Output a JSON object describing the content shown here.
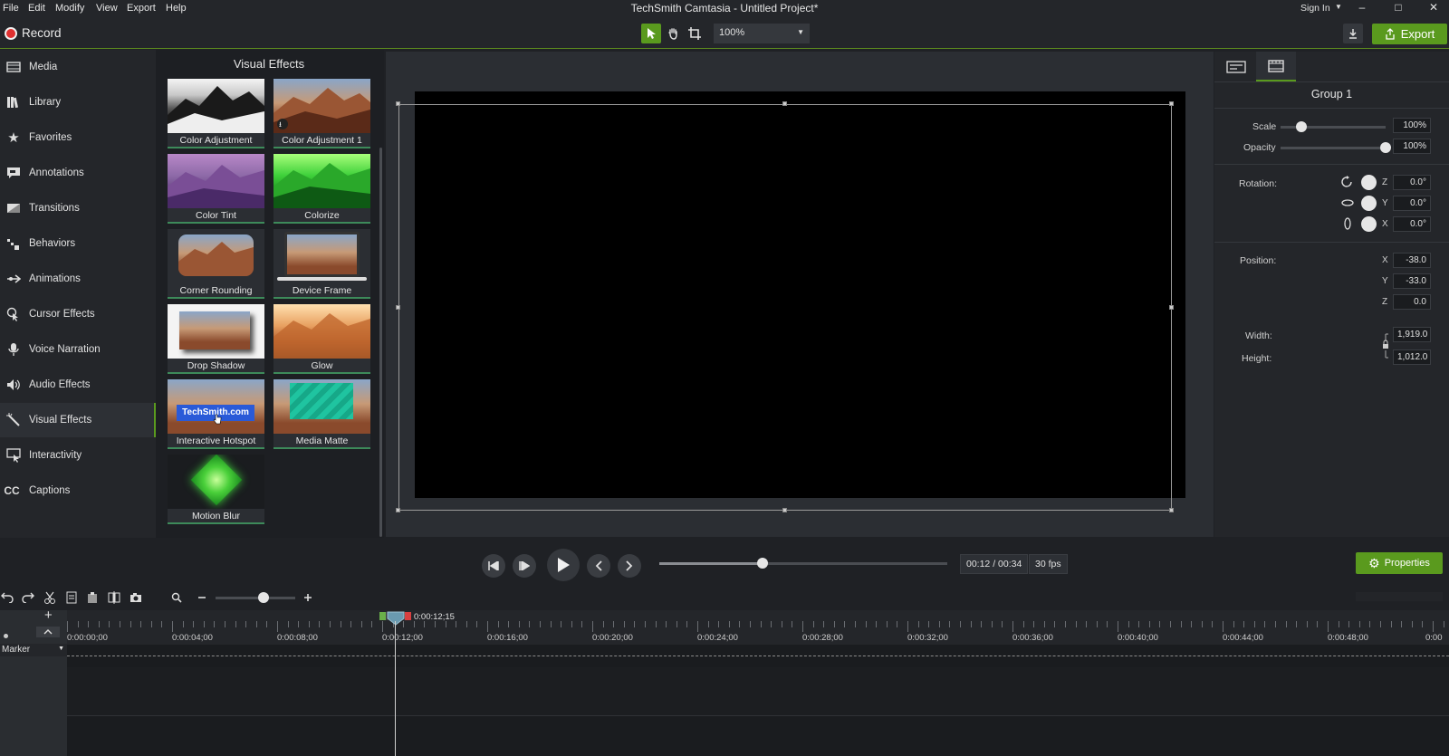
{
  "menu": [
    "File",
    "Edit",
    "Modify",
    "View",
    "Export",
    "Help"
  ],
  "window_title": "TechSmith Camtasia - Untitled Project*",
  "sign_in": "Sign In",
  "toolbar": {
    "record_label": "Record",
    "zoom_value": "100%",
    "export_label": "Export"
  },
  "nav": {
    "items": [
      {
        "label": "Media",
        "icon": "media-icon"
      },
      {
        "label": "Library",
        "icon": "library-icon"
      },
      {
        "label": "Favorites",
        "icon": "star-icon"
      },
      {
        "label": "Annotations",
        "icon": "annotation-icon"
      },
      {
        "label": "Transitions",
        "icon": "transition-icon"
      },
      {
        "label": "Behaviors",
        "icon": "behaviors-icon"
      },
      {
        "label": "Animations",
        "icon": "animation-icon"
      },
      {
        "label": "Cursor Effects",
        "icon": "cursor-icon"
      },
      {
        "label": "Voice Narration",
        "icon": "microphone-icon"
      },
      {
        "label": "Audio Effects",
        "icon": "speaker-icon"
      },
      {
        "label": "Visual Effects",
        "icon": "magic-wand-icon",
        "active": true
      },
      {
        "label": "Interactivity",
        "icon": "interactivity-icon"
      },
      {
        "label": "Captions",
        "icon": "captions-icon"
      }
    ]
  },
  "effects_panel": {
    "title": "Visual Effects",
    "tiles": [
      "Color Adjustment",
      "Color Adjustment 1",
      "Color Tint",
      "Colorize",
      "Corner Rounding",
      "Device Frame",
      "Drop Shadow",
      "Glow",
      "Interactive Hotspot",
      "Media Matte",
      "Motion Blur"
    ],
    "hotspot_text": "TechSmith.com"
  },
  "properties": {
    "group_title": "Group 1",
    "scale_label": "Scale",
    "scale_value": "100%",
    "scale_level": 0.2,
    "opacity_label": "Opacity",
    "opacity_value": "100%",
    "opacity_level": 1.0,
    "rotation_label": "Rotation:",
    "rotation": [
      {
        "axis": "Z",
        "value": "0.0°"
      },
      {
        "axis": "Y",
        "value": "0.0°"
      },
      {
        "axis": "X",
        "value": "0.0°"
      }
    ],
    "position_label": "Position:",
    "position": [
      {
        "axis": "X",
        "value": "-38.0"
      },
      {
        "axis": "Y",
        "value": "-33.0"
      },
      {
        "axis": "Z",
        "value": "0.0"
      }
    ],
    "width_label": "Width:",
    "width_value": "1,919.0",
    "height_label": "Height:",
    "height_value": "1,012.0"
  },
  "playback": {
    "time_current": "00:12",
    "time_total": "00:34",
    "time_separator": "/",
    "fps": "30 fps",
    "progress": 0.36,
    "properties_label": "Properties"
  },
  "timeline": {
    "playhead_time": "0:00:12;15",
    "ticks": [
      "0:00:00;00",
      "0:00:04;00",
      "0:00:08;00",
      "0:00:12;00",
      "0:00:16;00",
      "0:00:20;00",
      "0:00:24;00",
      "0:00:28;00",
      "0:00:32;00",
      "0:00:36;00",
      "0:00:40;00",
      "0:00:44;00",
      "0:00:48;00",
      "0:00"
    ],
    "marker_label": "Marker"
  },
  "colors": {
    "accent_green": "#5a9a1e",
    "record_red": "#e03030"
  }
}
